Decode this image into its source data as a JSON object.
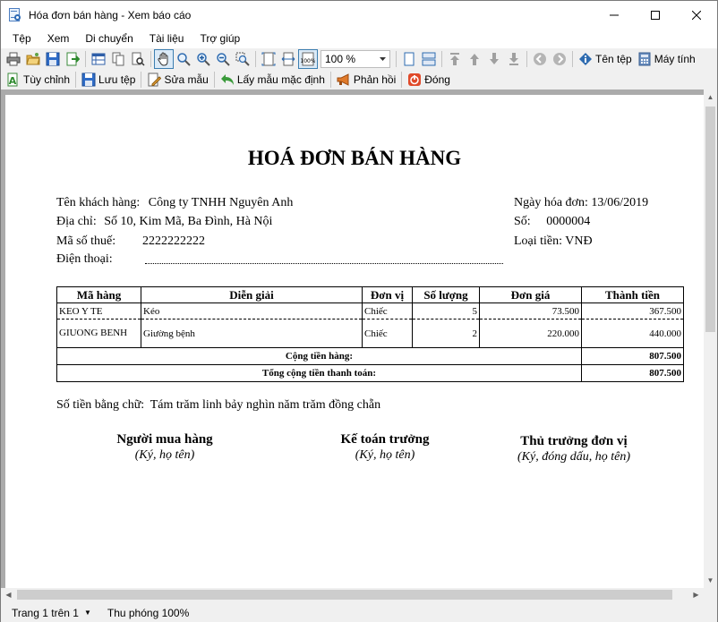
{
  "window": {
    "title": "Hóa đơn bán hàng - Xem báo cáo"
  },
  "menu": [
    "Tệp",
    "Xem",
    "Di chuyển",
    "Tài liệu",
    "Trợ giúp"
  ],
  "toolbar": {
    "zoom_value": "100 %",
    "file_name_label": "Tên tệp",
    "printer_label": "Máy tính"
  },
  "toolbar2": {
    "customize": "Tùy chỉnh",
    "save_file": "Lưu tệp",
    "edit_template": "Sửa mẫu",
    "default_template": "Lấy mẫu mặc định",
    "feedback": "Phản hồi",
    "close": "Đóng"
  },
  "invoice": {
    "title": "HOÁ ĐƠN BÁN HÀNG",
    "customer_label": "Tên khách hàng:",
    "customer_value": "Công ty TNHH Nguyên Anh",
    "address_label": "Địa chỉ:",
    "address_value": "Số 10, Kim Mã, Ba Đình, Hà Nội",
    "tax_label": "Mã số thuế:",
    "tax_value": "2222222222",
    "phone_label": "Điện thoại:",
    "date_label": "Ngày hóa đơn:",
    "date_value": "13/06/2019",
    "number_label": "Số:",
    "number_value": "0000004",
    "currency_label": "Loại tiền:",
    "currency_value": "VNĐ",
    "columns": [
      "Mã hàng",
      "Diễn giải",
      "Đơn vị",
      "Số lượng",
      "Đơn giá",
      "Thành tiền"
    ],
    "rows": [
      {
        "code": "KEO Y TE",
        "desc": "Kéo",
        "unit": "Chiếc",
        "qty": "5",
        "price": "73.500",
        "amount": "367.500"
      },
      {
        "code": "GIUONG BENH",
        "desc": "Giường bệnh",
        "unit": "Chiếc",
        "qty": "2",
        "price": "220.000",
        "amount": "440.000"
      }
    ],
    "subtotal_label": "Cộng tiền hàng:",
    "subtotal_value": "807.500",
    "total_label": "Tổng cộng tiền thanh toán:",
    "total_value": "807.500",
    "words_label": "Số tiền bằng chữ:",
    "words_value": "Tám trăm linh bảy nghìn năm trăm đồng chẵn",
    "signatures": [
      {
        "title": "Người mua hàng",
        "sub": "(Ký, họ tên)"
      },
      {
        "title": "Kế toán trưởng",
        "sub": "(Ký, họ tên)"
      },
      {
        "title": "Thủ trưởng đơn vị",
        "sub": "(Ký, đóng dấu, họ tên)"
      }
    ]
  },
  "status": {
    "page": "Trang 1 trên 1",
    "zoom": "Thu phóng 100%"
  }
}
